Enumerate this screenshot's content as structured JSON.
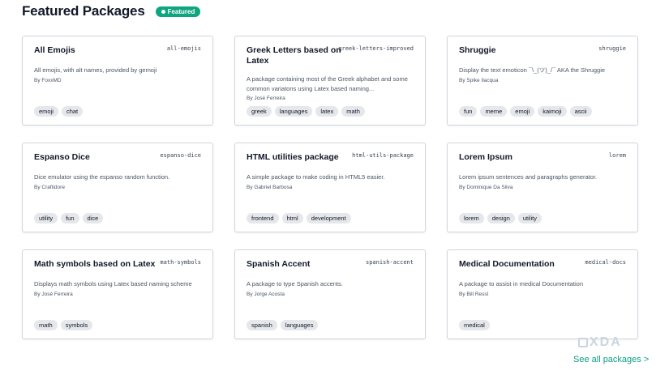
{
  "header": {
    "title": "Featured Packages",
    "badge": "Featured"
  },
  "cards": [
    {
      "title": "All Emojis",
      "id": "all-emojis",
      "desc": "All emojis, with alt names, provided by gemoji",
      "author": "By FoxxMD",
      "tags": [
        "emoji",
        "chat"
      ]
    },
    {
      "title": "Greek Letters based on Latex",
      "id": "greek-letters-improved",
      "desc": "A package containing most of the Greek alphabet and some common variatons using Latex based naming...",
      "author": "By José Ferreira",
      "tags": [
        "greek",
        "languages",
        "latex",
        "math"
      ]
    },
    {
      "title": "Shruggie",
      "id": "shruggie",
      "desc": "Display the text emoticon ¯\\_(ツ)_/¯ AKA the Shruggie",
      "author": "By Spike Ilacqua",
      "tags": [
        "fun",
        "meme",
        "emoji",
        "kaimoji",
        "ascii"
      ]
    },
    {
      "title": "Espanso Dice",
      "id": "espanso-dice",
      "desc": "Dice emulator using the espanso random function.",
      "author": "By Craftidore",
      "tags": [
        "utility",
        "fun",
        "dice"
      ]
    },
    {
      "title": "HTML utilities package",
      "id": "html-utils-package",
      "desc": "A simple package to make coding in HTML5 easier.",
      "author": "By Gabriel Barbosa",
      "tags": [
        "frontend",
        "html",
        "development"
      ]
    },
    {
      "title": "Lorem Ipsum",
      "id": "lorem",
      "desc": "Lorem ipsum sentences and paragraphs generator.",
      "author": "By Dominique Da Silva",
      "tags": [
        "lorem",
        "design",
        "utility"
      ]
    },
    {
      "title": "Math symbols based on Latex",
      "id": "math-symbols",
      "desc": "Displays math symbols using Latex based naming scheme",
      "author": "By José Ferreira",
      "tags": [
        "math",
        "symbols"
      ]
    },
    {
      "title": "Spanish Accent",
      "id": "spanish-accent",
      "desc": "A package to type Spanish accents.",
      "author": "By Jorge Acosta",
      "tags": [
        "spanish",
        "languages"
      ]
    },
    {
      "title": "Medical Documentation",
      "id": "medical-docs",
      "desc": "A package to assist in medical Documentation",
      "author": "By Bill Ressl",
      "tags": [
        "medical"
      ]
    }
  ],
  "footer": {
    "see_all": "See all packages >",
    "watermark": "XDA"
  },
  "colors": {
    "accent": "#0ea57f",
    "link": "#0e9f86",
    "tag_bg": "#e5e7eb",
    "border": "#d1d5db"
  }
}
